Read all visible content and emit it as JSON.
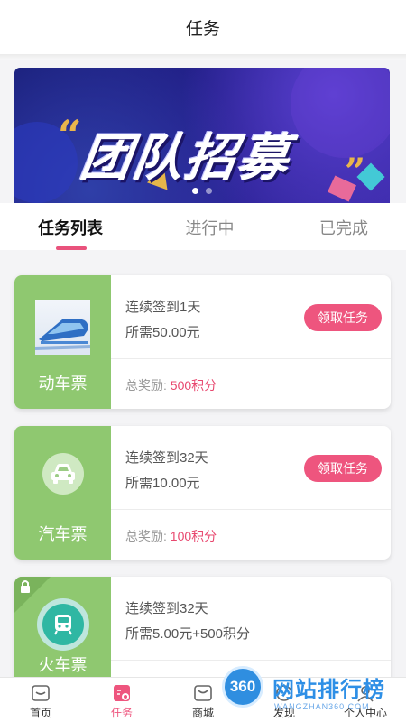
{
  "header": {
    "title": "任务"
  },
  "banner": {
    "headline": "团队招募",
    "quote_open": "“",
    "quote_close": "”"
  },
  "tabs": [
    {
      "label": "任务列表",
      "active": true
    },
    {
      "label": "进行中",
      "active": false
    },
    {
      "label": "已完成",
      "active": false
    }
  ],
  "tasks": [
    {
      "name": "动车票",
      "icon": "bullet-train-image",
      "line1": "连续签到1天",
      "line2": "所需50.00元",
      "button": "领取任务",
      "reward_label": "总奖励:",
      "reward_value": "500积分"
    },
    {
      "name": "汽车票",
      "icon": "car-icon",
      "line1": "连续签到32天",
      "line2": "所需10.00元",
      "button": "领取任务",
      "reward_label": "总奖励:",
      "reward_value": "100积分"
    },
    {
      "name": "火车票",
      "icon": "train-icon",
      "locked": true,
      "line1": "连续签到32天",
      "line2": "所需5.00元+500积分"
    }
  ],
  "tabbar": [
    {
      "label": "首页",
      "icon": "home-icon",
      "active": false
    },
    {
      "label": "任务",
      "icon": "task-icon",
      "active": true
    },
    {
      "label": "商城",
      "icon": "mall-icon",
      "active": false
    },
    {
      "label": "发现",
      "icon": "discover-icon",
      "active": false
    },
    {
      "label": "个人中心",
      "icon": "profile-icon",
      "active": false
    }
  ],
  "watermark": {
    "logo": "360",
    "text": "网站排行榜",
    "sub": "WANGZHAN360.COM"
  },
  "colors": {
    "accent": "#ee557e",
    "card_left": "#8fc870",
    "reward": "#e8486f"
  }
}
